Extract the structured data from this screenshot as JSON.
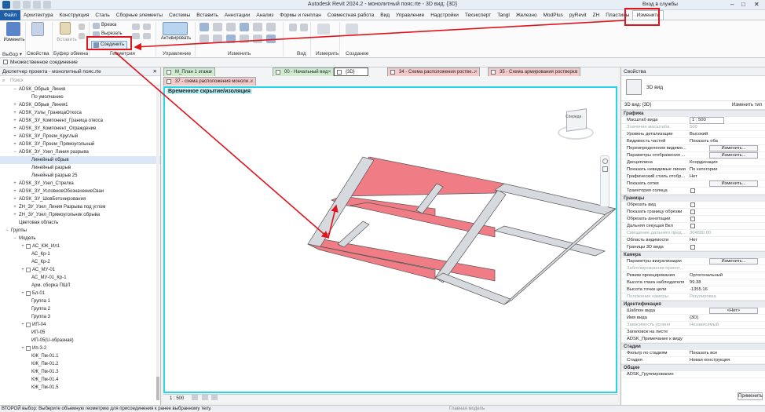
{
  "window": {
    "title": "Autodesk Revit 2024.2 - монолитный пояс.rte - 3D вид: {3D}",
    "signin": "Вход в службы"
  },
  "menu": [
    "Архитектура",
    "Конструкция",
    "Сталь",
    "Сборные элементы",
    "Системы",
    "Вставить",
    "Аннотации",
    "Анализ",
    "Формы и генплан",
    "Совместная работа",
    "Вид",
    "Управление",
    "Надстройки",
    "Техэксперт",
    "Tangl",
    "Железно",
    "ModPlus",
    "pyRevit",
    "ZH",
    "Пластины",
    "Изменить"
  ],
  "menu_file": "Файл",
  "ribbon": {
    "modify_label": "Изменить",
    "properties_label": "Свойства",
    "clipboard_label": "Буфер обмена",
    "cut_label": "Врезка",
    "cutout_label": "Вырезать",
    "join_label": "Соединить",
    "activate_label": "Активировать",
    "groups": [
      "Выбор ▾",
      "Свойства",
      "Буфер обмена",
      "Геометрия",
      "Управление",
      "Изменить",
      "Вид",
      "Измерить",
      "Создание"
    ]
  },
  "options": {
    "multiple_join": "Множественное соединение"
  },
  "browser": {
    "title": "Диспетчер проекта - монолитный пояс.rte",
    "search_placeholder": "Поиск",
    "rows": [
      {
        "t": "ADSK_Обрыв_Линия",
        "ex": "−",
        "d": 1
      },
      {
        "t": "По умолчанию",
        "ex": "",
        "d": 2
      },
      {
        "t": "ADSK_Обрыв_Линия1",
        "ex": "+",
        "d": 1
      },
      {
        "t": "ADSK_Узлы_ГраницаОткоса",
        "ex": "+",
        "d": 1
      },
      {
        "t": "ADSK_ЗУ_Компонент_Граница откоса",
        "ex": "+",
        "d": 1
      },
      {
        "t": "ADSK_ЗУ_Компонент_Ограждение",
        "ex": "+",
        "d": 1
      },
      {
        "t": "ADSK_ЗУ_Проем_Круглый",
        "ex": "+",
        "d": 1
      },
      {
        "t": "ADSK_ЗУ_Проем_Прямоугольный",
        "ex": "+",
        "d": 1
      },
      {
        "t": "ADSK_ЗУ_Узел_Линия разрыва",
        "ex": "−",
        "d": 1
      },
      {
        "t": "Линейный обрыв",
        "ex": "",
        "d": 2,
        "sel": true
      },
      {
        "t": "Линейный разрыв",
        "ex": "",
        "d": 2
      },
      {
        "t": "Линейный разрыв 25",
        "ex": "",
        "d": 2
      },
      {
        "t": "ADSK_ЗУ_Узел_Стрелка",
        "ex": "+",
        "d": 1
      },
      {
        "t": "ADSK_ЗУ_УсловноеОбозначениеСваи",
        "ex": "+",
        "d": 1
      },
      {
        "t": "ADSK_ЗУ_ШовБетонирования",
        "ex": "+",
        "d": 1
      },
      {
        "t": "ZH_ЗУ_Узел_Линия Разрыва под углом",
        "ex": "+",
        "d": 1
      },
      {
        "t": "ZH_ЗУ_Узел_Прямоугольник обрыва",
        "ex": "+",
        "d": 1
      },
      {
        "t": "Цветовая область",
        "ex": "",
        "d": 1
      },
      {
        "t": "Группы",
        "ex": "−",
        "d": 0
      },
      {
        "t": "Модель",
        "ex": "−",
        "d": 1
      },
      {
        "t": "АС_КЖ_Ил1",
        "ex": "+",
        "d": 2
      },
      {
        "t": "АС_Кр-1",
        "ex": "",
        "d": 2
      },
      {
        "t": "АС_Кр-2",
        "ex": "",
        "d": 2
      },
      {
        "t": "АС_МУ-01",
        "ex": "+",
        "d": 2
      },
      {
        "t": "АС_МУ-01_Кр-1",
        "ex": "",
        "d": 2
      },
      {
        "t": "Арм. сборка ПШЛ",
        "ex": "",
        "d": 2
      },
      {
        "t": "Бл-01",
        "ex": "+",
        "d": 2
      },
      {
        "t": "Группа 1",
        "ex": "",
        "d": 2
      },
      {
        "t": "Группа 2",
        "ex": "",
        "d": 2
      },
      {
        "t": "Группа 3",
        "ex": "",
        "d": 2
      },
      {
        "t": "ИП-04",
        "ex": "+",
        "d": 2
      },
      {
        "t": "ИП-05",
        "ex": "",
        "d": 2
      },
      {
        "t": "ИП-05(U-образная)",
        "ex": "",
        "d": 2
      },
      {
        "t": "Ип-3-2",
        "ex": "+",
        "d": 2
      },
      {
        "t": "КЖ_Пм-01.1",
        "ex": "",
        "d": 2
      },
      {
        "t": "КЖ_Пм-01.2",
        "ex": "",
        "d": 2
      },
      {
        "t": "КЖ_Пм-01.3",
        "ex": "",
        "d": 2
      },
      {
        "t": "КЖ_Пм-01.4",
        "ex": "",
        "d": 2
      },
      {
        "t": "КЖ_Пм-01.5",
        "ex": "",
        "d": 2
      }
    ]
  },
  "view_tabs": [
    {
      "label": "М_План 1 этажа",
      "cls": "green"
    },
    {
      "label": "00 - Начальный вид",
      "cls": "green"
    },
    {
      "label": "{3D}",
      "cls": "cur"
    },
    {
      "label": "34 - Схема расположения роствe...",
      "cls": "pink"
    },
    {
      "label": "35 - Схема армирования ростверка",
      "cls": "pink"
    },
    {
      "label": "37 - схема расположения моноли...",
      "cls": "pink"
    }
  ],
  "viewport": {
    "temp_hide": "Временное скрытие/изоляция",
    "cube_label": "Спереди"
  },
  "viewbar": {
    "scale": "1 : 500"
  },
  "properties": {
    "title": "Свойства",
    "type_name": "3D вид",
    "instance": "3D вид: {3D}",
    "edit_type": "Изменить тип",
    "sections": [
      {
        "name": "Графика",
        "rows": [
          {
            "k": "Масштаб вида",
            "v": "1 : 500",
            "kind": "box"
          },
          {
            "k": "Значение масштаба",
            "v": "500",
            "kind": "dim"
          },
          {
            "k": "Уровень детализации",
            "v": "Высокий"
          },
          {
            "k": "Видимость частей",
            "v": "Показать оба"
          },
          {
            "k": "Переопределения видимо...",
            "v": "Изменить...",
            "kind": "btn"
          },
          {
            "k": "Параметры отображения ...",
            "v": "Изменить...",
            "kind": "btn"
          },
          {
            "k": "Дисциплина",
            "v": "Координация"
          },
          {
            "k": "Показать невидимые линии",
            "v": "По категории"
          },
          {
            "k": "Графический стиль отобр...",
            "v": "Нет"
          },
          {
            "k": "Показать сетки",
            "v": "Изменить...",
            "kind": "btn"
          },
          {
            "k": "Траектория солнца",
            "v": "",
            "kind": "chk"
          }
        ]
      },
      {
        "name": "Границы",
        "rows": [
          {
            "k": "Обрезать вид",
            "v": "",
            "kind": "chk"
          },
          {
            "k": "Показать границу обрезки",
            "v": "",
            "kind": "chk"
          },
          {
            "k": "Обрезать аннотации",
            "v": "",
            "kind": "chk"
          },
          {
            "k": "Дальняя секущая Вкл",
            "v": "",
            "kind": "chk"
          },
          {
            "k": "Смещение дальнего пред...",
            "v": "304800.00",
            "kind": "dim"
          },
          {
            "k": "Область видимости",
            "v": "Нет"
          },
          {
            "k": "Границы 3D вида",
            "v": "",
            "kind": "chk"
          }
        ]
      },
      {
        "name": "Камера",
        "rows": [
          {
            "k": "Параметры визуализации",
            "v": "Изменить...",
            "kind": "btn"
          },
          {
            "k": "Заблокированная ориент...",
            "v": "",
            "kind": "dim"
          },
          {
            "k": "Режим проецирования",
            "v": "Ортогональный"
          },
          {
            "k": "Высота глаза наблюдателя",
            "v": "99.38"
          },
          {
            "k": "Высота точки цели",
            "v": "-1355.16"
          },
          {
            "k": "Положение камеры",
            "v": "Регулировка",
            "kind": "dim"
          }
        ]
      },
      {
        "name": "Идентификация",
        "rows": [
          {
            "k": "Шаблон вида",
            "v": "<Нет>",
            "kind": "btn"
          },
          {
            "k": "Имя вида",
            "v": "{3D}"
          },
          {
            "k": "Зависимость уровня",
            "v": "Независимый",
            "kind": "dim"
          },
          {
            "k": "Заголовок на листе",
            "v": ""
          },
          {
            "k": "ADSK_Примечание к виду",
            "v": ""
          }
        ]
      },
      {
        "name": "Стадии",
        "rows": [
          {
            "k": "Фильтр по стадиям",
            "v": "Показать все"
          },
          {
            "k": "Стадия",
            "v": "Новая конструкция"
          }
        ]
      },
      {
        "name": "Общие",
        "rows": [
          {
            "k": "ADSK_Группирование",
            "v": ""
          }
        ]
      }
    ],
    "apply": "Применить"
  },
  "status": {
    "text": "ВТОРОЙ выбор: Выберите объемную геометрию для присоединения к ранее выбранному телу.",
    "main_model": "Главная модель"
  },
  "colors": {
    "beam_red": "#f07c85",
    "beam_gray": "#d6d9de",
    "cyan_border": "#28d4e6",
    "annotation_red": "#e0141c"
  }
}
